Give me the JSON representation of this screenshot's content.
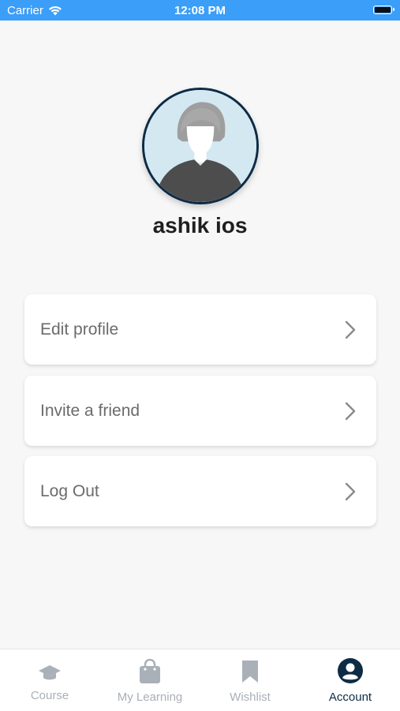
{
  "status_bar": {
    "carrier": "Carrier",
    "time": "12:08 PM"
  },
  "profile": {
    "name": "ashik ios"
  },
  "menu": [
    {
      "label": "Edit profile"
    },
    {
      "label": "Invite a friend"
    },
    {
      "label": "Log Out"
    }
  ],
  "tabs": [
    {
      "label": "Course",
      "icon": "graduation-cap-icon"
    },
    {
      "label": "My Learning",
      "icon": "shopping-bag-icon"
    },
    {
      "label": "Wishlist",
      "icon": "bookmark-icon"
    },
    {
      "label": "Account",
      "icon": "account-circle-icon",
      "active": true
    }
  ],
  "colors": {
    "status_bar": "#3b9ef8",
    "active_tab": "#0d2b45",
    "inactive_tab": "#a9b0b8"
  }
}
